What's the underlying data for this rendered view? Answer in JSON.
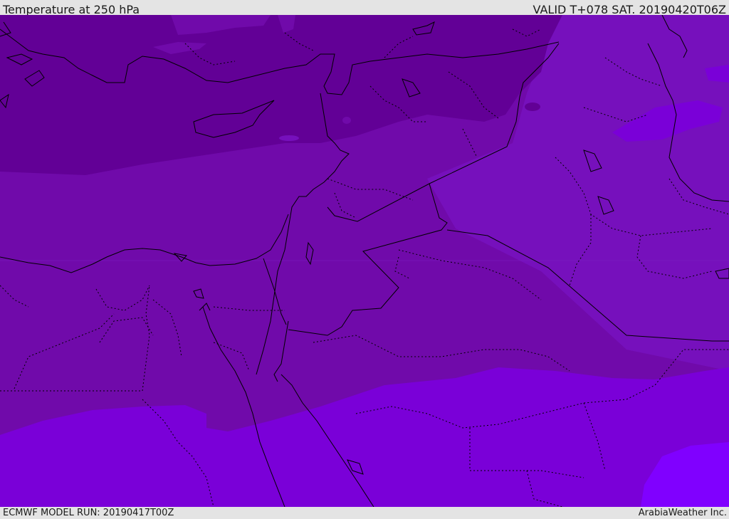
{
  "header": {
    "title": "Temperature at 250 hPa",
    "valid_time": "VALID T+078 SAT. 20190420T06Z"
  },
  "footer": {
    "model_run": "ECMWF MODEL RUN: 20190417T00Z",
    "credit": "ArabiaWeather Inc."
  },
  "map": {
    "field_colors": {
      "coldest_band": "#620096",
      "mid_band": "#700aaa",
      "warm_band": "#7a00d8",
      "warmest_band": "#8000ff"
    },
    "line_colors": {
      "coastline": "#000000",
      "border": "#000000"
    }
  }
}
